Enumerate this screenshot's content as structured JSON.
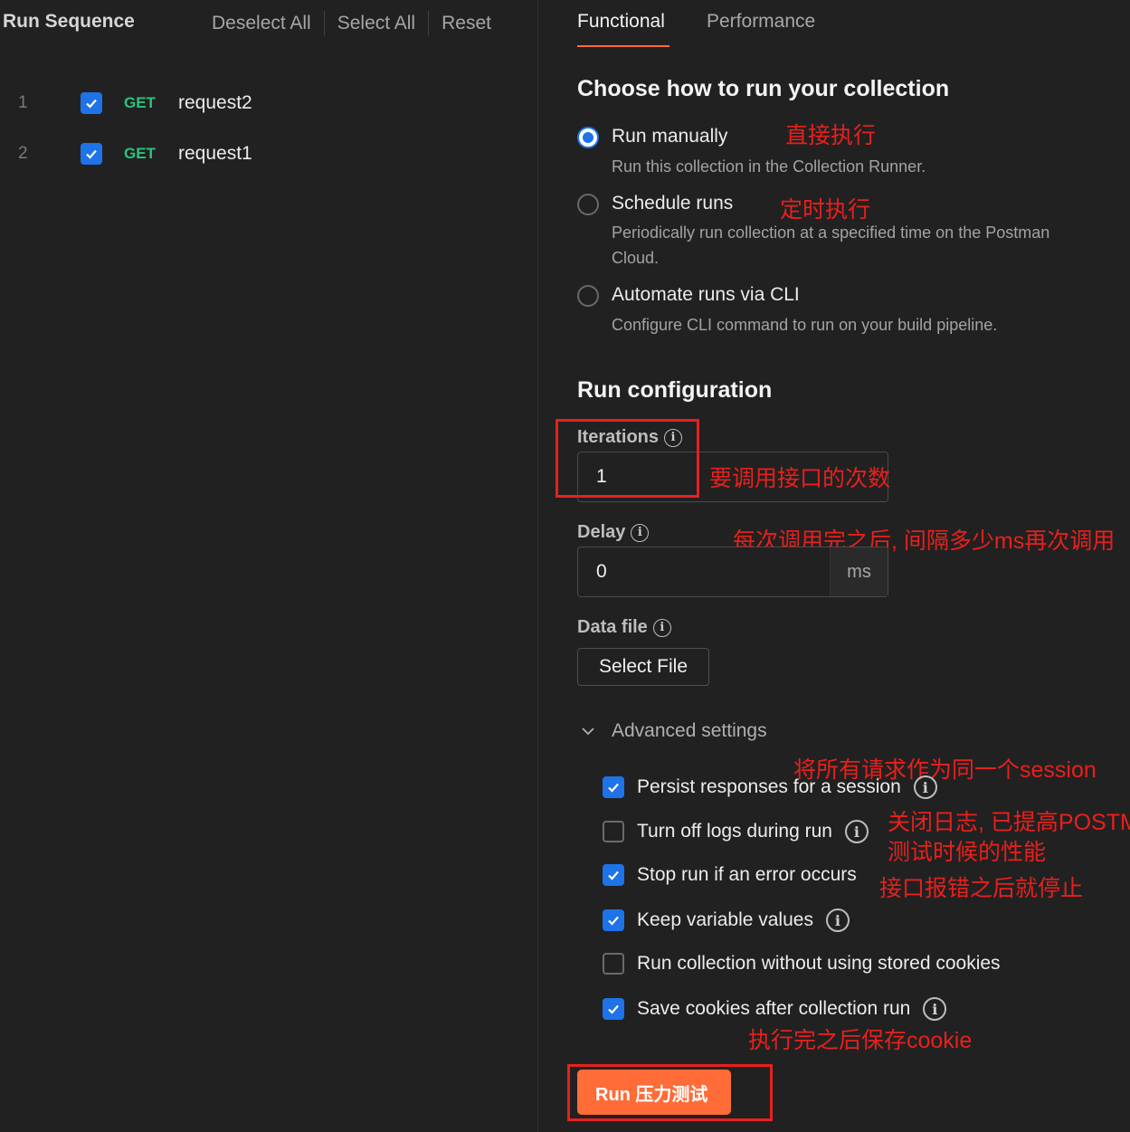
{
  "left": {
    "title": "Run Sequence",
    "actions": [
      "Deselect All",
      "Select All",
      "Reset"
    ],
    "requests": [
      {
        "index": "1",
        "method": "GET",
        "name": "request2",
        "checked": true
      },
      {
        "index": "2",
        "method": "GET",
        "name": "request1",
        "checked": true
      }
    ]
  },
  "tabs": [
    "Functional",
    "Performance"
  ],
  "choose": {
    "heading": "Choose how to run your collection",
    "options": [
      {
        "label": "Run manually",
        "desc": "Run this collection in the Collection Runner.",
        "selected": true,
        "note": "直接执行"
      },
      {
        "label": "Schedule runs",
        "desc": "Periodically run collection at a specified time on the Postman Cloud.",
        "selected": false,
        "note": "定时执行"
      },
      {
        "label": "Automate runs via CLI",
        "desc": "Configure CLI command to run on your build pipeline.",
        "selected": false
      }
    ]
  },
  "config": {
    "heading": "Run configuration",
    "iterations_label": "Iterations",
    "iterations_value": "1",
    "iterations_note": "要调用接口的次数",
    "delay_label": "Delay",
    "delay_value": "0",
    "delay_suffix": "ms",
    "delay_note": "每次调用完之后, 间隔多少ms再次调用",
    "datafile_label": "Data file",
    "select_file": "Select File"
  },
  "advanced": {
    "label": "Advanced settings",
    "items": [
      {
        "label": "Persist responses for a session",
        "checked": true,
        "info": true,
        "note": "将所有请求作为同一个session"
      },
      {
        "label": "Turn off logs during run",
        "checked": false,
        "info": true,
        "note": "关闭日志, 已提高POSTM",
        "note2": "测试时候的性能"
      },
      {
        "label": "Stop run if an error occurs",
        "checked": true,
        "info": false,
        "note": "接口报错之后就停止"
      },
      {
        "label": "Keep variable values",
        "checked": true,
        "info": true
      },
      {
        "label": "Run collection without using stored cookies",
        "checked": false,
        "info": false
      },
      {
        "label": "Save cookies after collection run",
        "checked": true,
        "info": true,
        "note": "执行完之后保存cookie"
      }
    ]
  },
  "run_button": "Run 压力测试",
  "info_glyph": "i",
  "colors": {
    "accent": "#ff6c37",
    "checkbox": "#1e73e8",
    "method_get": "#2ec27e",
    "annotation": "#e8201d"
  }
}
